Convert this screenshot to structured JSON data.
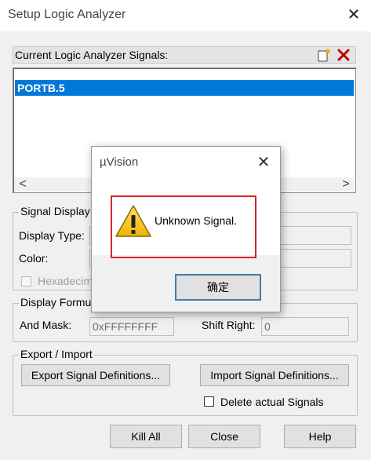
{
  "window": {
    "title": "Setup Logic Analyzer",
    "close_glyph": "✕"
  },
  "signals": {
    "label": "Current Logic Analyzer Signals:",
    "items": [
      "PORTB.5"
    ],
    "selected_index": 0,
    "new_icon": "new-signal-icon",
    "delete_icon": "delete-signal-icon",
    "scroll_left": "<",
    "scroll_right": ">"
  },
  "signal_display": {
    "legend": "Signal Display",
    "display_type_label": "Display Type:",
    "color_label": "Color:",
    "hexadecimal_label": "Hexadecim"
  },
  "display_formula": {
    "legend": "Display Formula",
    "and_mask_label": "And Mask:",
    "and_mask_value": "0xFFFFFFFF",
    "shift_right_label": "Shift Right:",
    "shift_right_value": "0"
  },
  "export_import": {
    "legend": "Export / Import",
    "export_button": "Export Signal Definitions...",
    "import_button": "Import Signal Definitions...",
    "delete_actual_label": "Delete actual Signals"
  },
  "footer": {
    "kill_all": "Kill All",
    "close": "Close",
    "help": "Help"
  },
  "dialog": {
    "title": "µVision",
    "close_glyph": "✕",
    "message": "Unknown Signal.",
    "ok_button": "确定",
    "icon": "warning-icon",
    "highlight_color": "#d9252a"
  },
  "colors": {
    "selection": "#0078d7",
    "delete_icon": "#c00000",
    "warning_yellow": "#f5c400"
  }
}
